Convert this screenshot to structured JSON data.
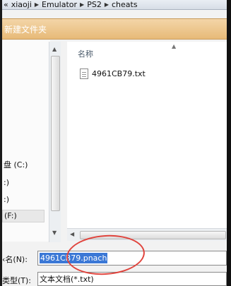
{
  "breadcrumb": {
    "back_glyph": "«",
    "items": [
      "xiaoji",
      "Emulator",
      "PS2",
      "cheats"
    ],
    "separator": "▶"
  },
  "toolbar": {
    "new_folder_label": "新建文件夹"
  },
  "navigation": {
    "items": [
      {
        "label": "盘 (C:)"
      },
      {
        "label": ":)"
      },
      {
        "label": ":)"
      },
      {
        "label": "(F:)"
      }
    ]
  },
  "file_list": {
    "column_header": "名称",
    "files": [
      {
        "name": "4961CB79.txt",
        "icon": "text-file-icon"
      }
    ]
  },
  "save_form": {
    "filename_label": "‹名(N):",
    "filename_value": "4961CB79.pnach",
    "filetype_label": "类型(T):",
    "filetype_value": "文本文档(*.txt)"
  },
  "colors": {
    "toolbar": "#e7ba78",
    "selection": "#3b78d6",
    "annotation_circle": "#e0443d"
  }
}
